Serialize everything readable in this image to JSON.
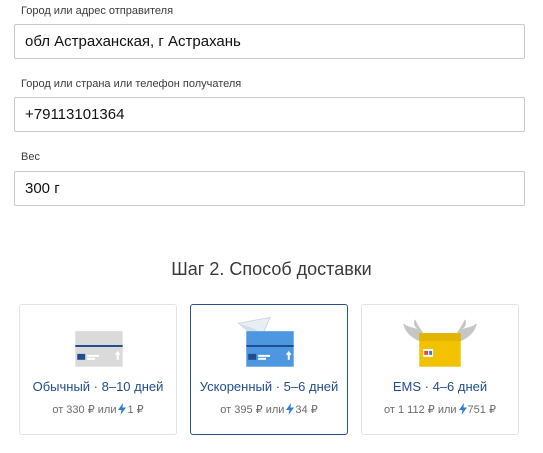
{
  "sender": {
    "label": "Город или адрес отправителя",
    "value": "обл Астраханская, г Астрахань"
  },
  "recipient": {
    "label": "Город или страна или телефон получателя",
    "value": "+79113101364"
  },
  "weight": {
    "label": "Вес",
    "value": "300 г"
  },
  "step": {
    "title": "Шаг 2. Способ доставки"
  },
  "options": [
    {
      "name": "Обычный · 8–10 дней",
      "price_prefix": "от 330 ₽ или",
      "points": "1 ₽",
      "icon": "envelope-grey-icon",
      "selected": false
    },
    {
      "name": "Ускоренный · 5–6 дней",
      "price_prefix": "от 395 ₽ или",
      "points": "34 ₽",
      "icon": "envelope-blue-paper-plane-icon",
      "selected": true
    },
    {
      "name": "EMS · 4–6 дней",
      "price_prefix": "от 1 112 ₽ или",
      "points": "751 ₽",
      "icon": "envelope-yellow-wings-icon",
      "selected": false
    }
  ],
  "colors": {
    "accent": "#1f4d8f",
    "selected_border": "#2a4f8e",
    "bolt": "#2d7fd3"
  }
}
